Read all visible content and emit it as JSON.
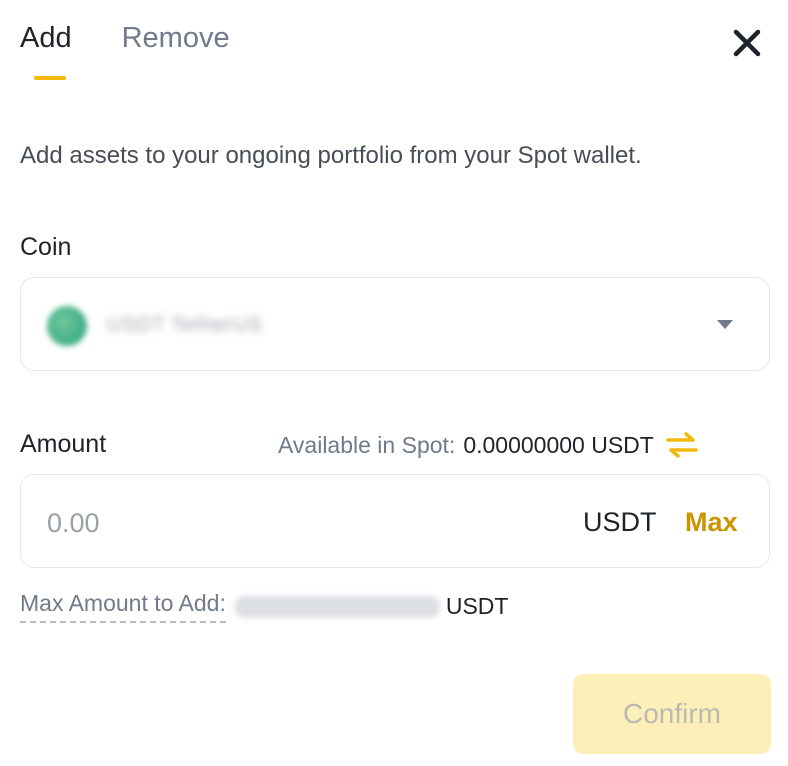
{
  "tabs": {
    "add": "Add",
    "remove": "Remove",
    "active": "Add"
  },
  "description": "Add assets to your ongoing portfolio from your Spot wallet.",
  "coin": {
    "label": "Coin",
    "selected_blurred": "USDT TetherUS"
  },
  "amount": {
    "label": "Amount",
    "available_label": "Available in Spot:",
    "available_value": "0.00000000 USDT",
    "placeholder": "0.00",
    "unit": "USDT",
    "max_button": "Max"
  },
  "max_add": {
    "label": "Max Amount to Add:",
    "unit": "USDT"
  },
  "confirm_label": "Confirm",
  "colors": {
    "accent": "#f0b90b",
    "max": "#c99400",
    "confirm_bg": "#fcefb8"
  },
  "icons": {
    "close": "close-icon",
    "swap": "swap-arrows-icon",
    "caret": "caret-down-icon",
    "coin": "coin-icon"
  }
}
